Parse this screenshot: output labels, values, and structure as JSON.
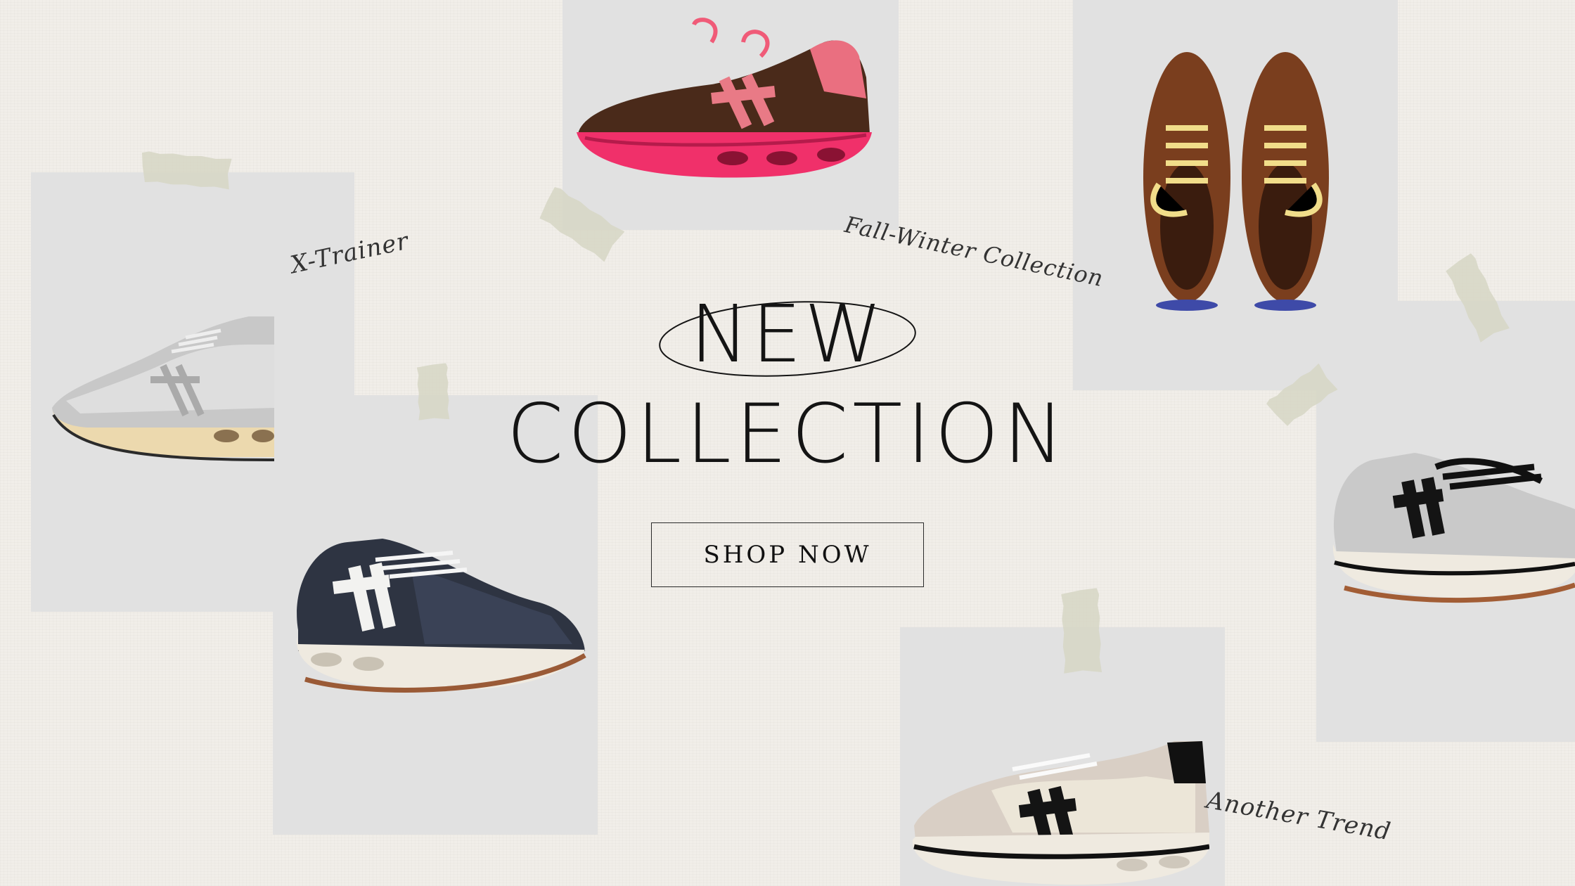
{
  "hero": {
    "title_line1": "NEW",
    "title_line2": "COLLECTION",
    "cta_label": "SHOP NOW"
  },
  "captions": {
    "x_trainer": "X-Trainer",
    "fall_winter": "Fall-Winter Collection",
    "another_trend": "Another Trend"
  },
  "colors": {
    "background": "#f1eee9",
    "card": "#e1e1e1",
    "tape": "#d6d6c4",
    "text": "#141414"
  },
  "products": [
    {
      "name": "silver-sneaker-icon"
    },
    {
      "name": "pink-brown-sneaker-icon"
    },
    {
      "name": "brown-sneaker-pair-icon"
    },
    {
      "name": "navy-sneaker-icon"
    },
    {
      "name": "silver-black-sneaker-icon"
    },
    {
      "name": "beige-sneaker-icon"
    }
  ]
}
